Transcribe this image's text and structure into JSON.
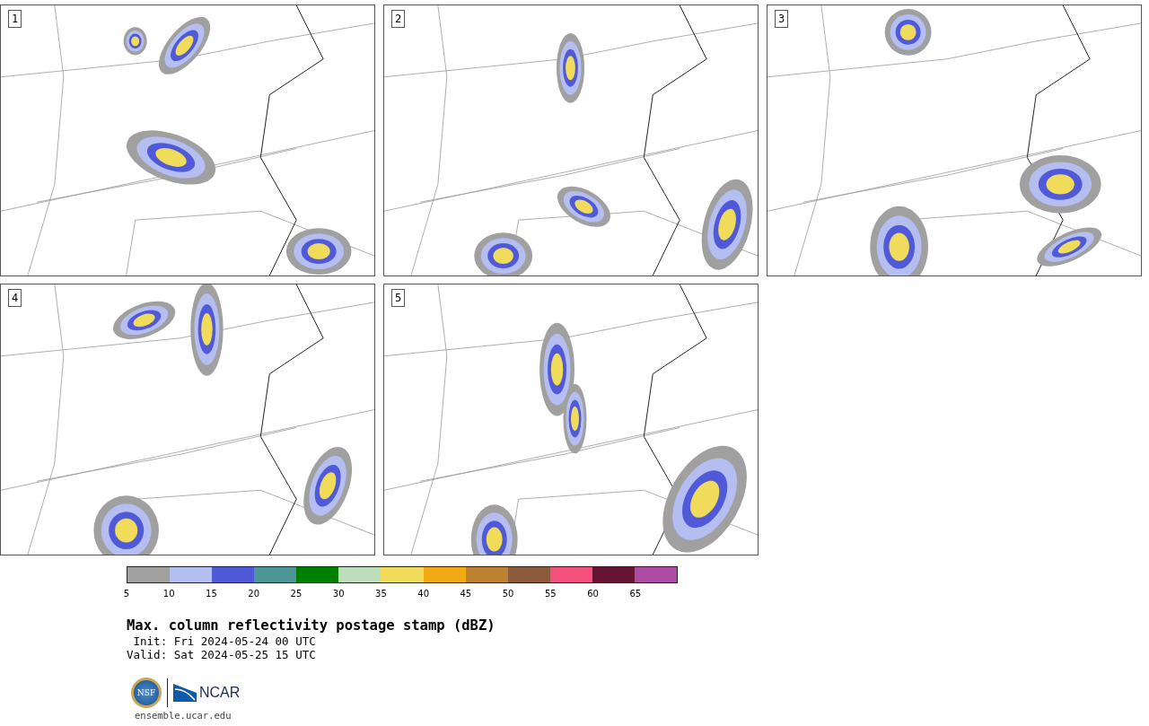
{
  "panels": [
    {
      "label": "1"
    },
    {
      "label": "2"
    },
    {
      "label": "3"
    },
    {
      "label": "4"
    },
    {
      "label": "5"
    }
  ],
  "colorbar": {
    "segments": [
      {
        "tick": "5",
        "color": "#a0a0a0"
      },
      {
        "tick": "10",
        "color": "#b4bef0"
      },
      {
        "tick": "15",
        "color": "#505ad8"
      },
      {
        "tick": "20",
        "color": "#4e9598"
      },
      {
        "tick": "25",
        "color": "#008000"
      },
      {
        "tick": "30",
        "color": "#bcdcbc"
      },
      {
        "tick": "35",
        "color": "#f0dc5a"
      },
      {
        "tick": "40",
        "color": "#f0aa14"
      },
      {
        "tick": "45",
        "color": "#bc8232"
      },
      {
        "tick": "50",
        "color": "#8c5a3c"
      },
      {
        "tick": "55",
        "color": "#f4507c"
      },
      {
        "tick": "60",
        "color": "#641632"
      },
      {
        "tick": "65",
        "color": "#ac4ca4"
      }
    ]
  },
  "title": "Max. column reflectivity postage stamp (dBZ)",
  "init": " Init: Fri 2024-05-24 00 UTC",
  "valid": "Valid: Sat 2024-05-25 15 UTC",
  "logos": {
    "nsf": "NSF",
    "ncar": "NCAR"
  },
  "url": "ensemble.ucar.edu"
}
